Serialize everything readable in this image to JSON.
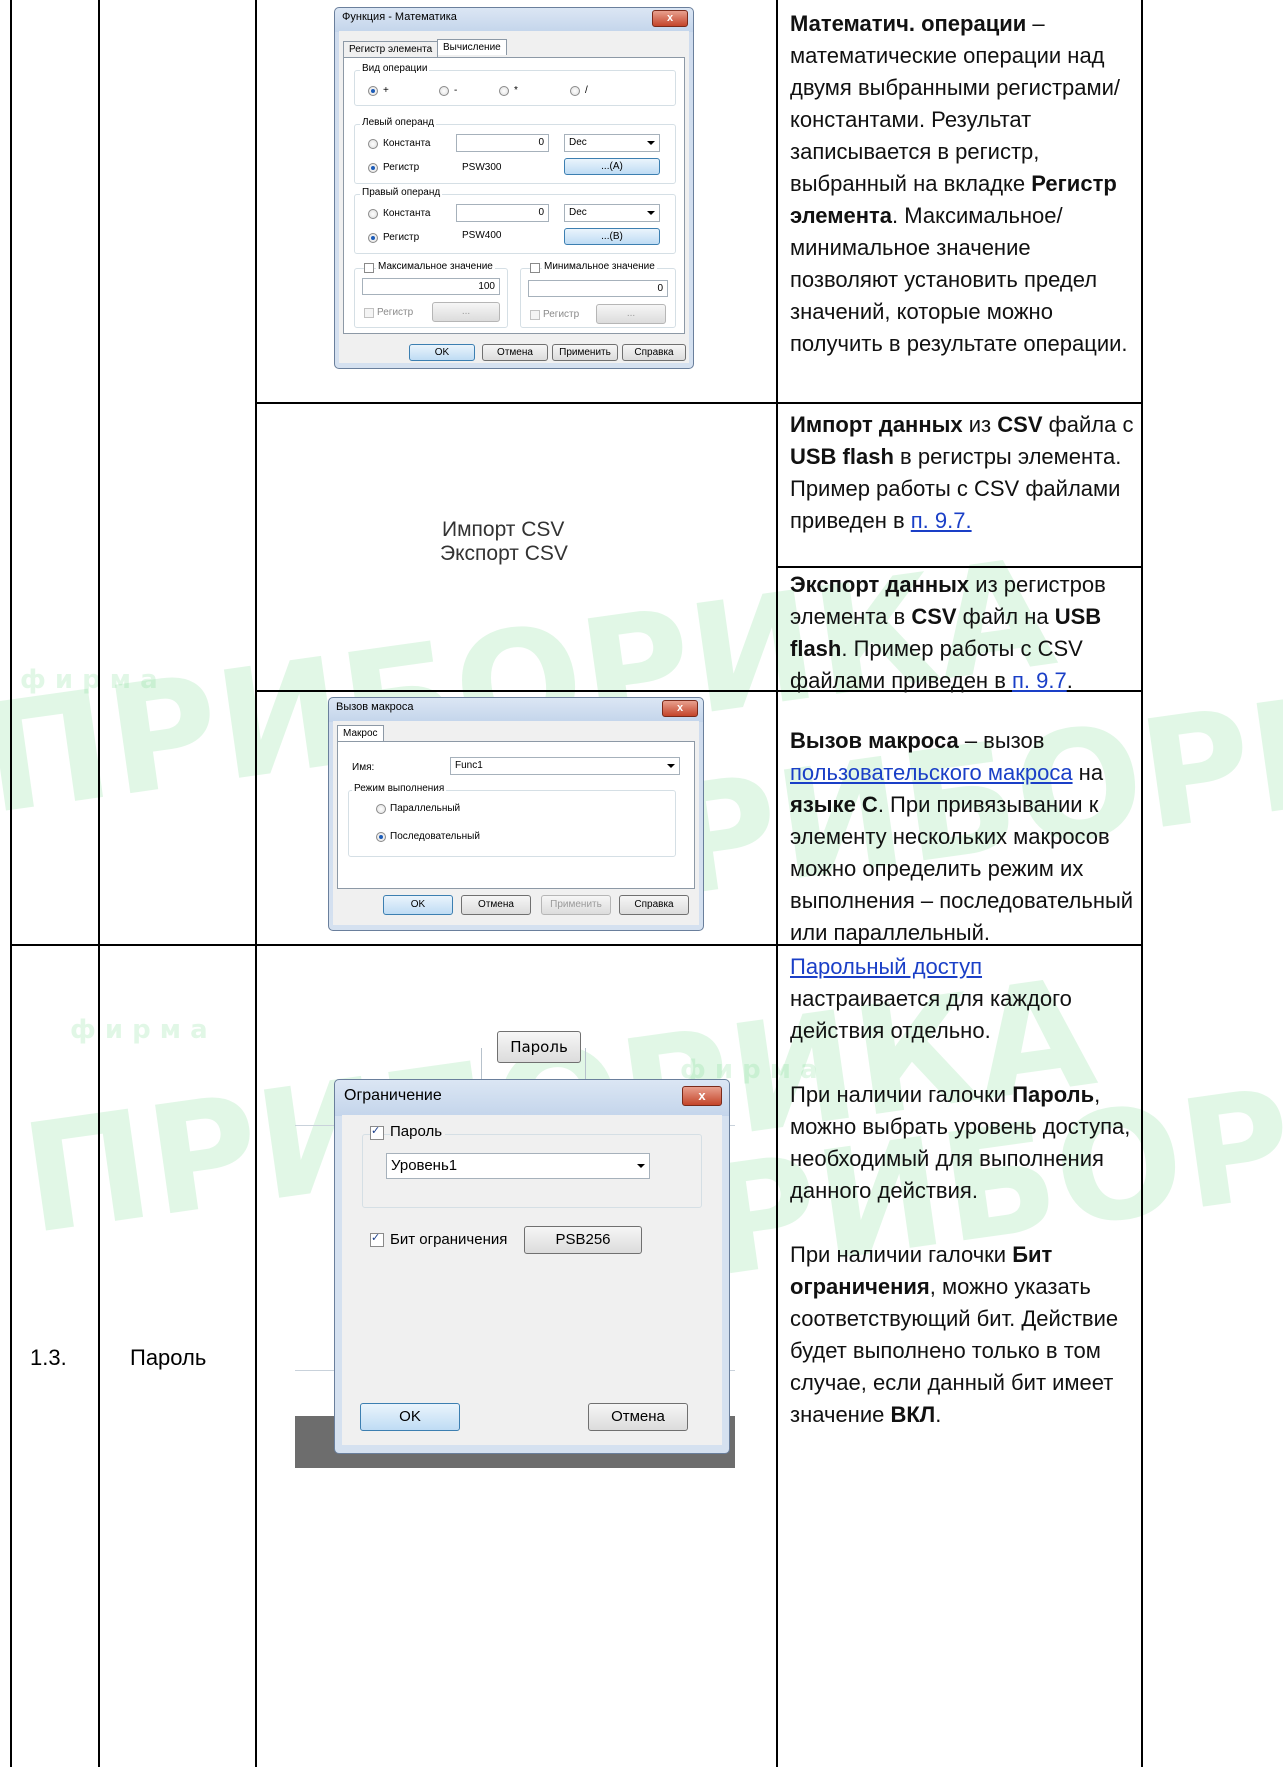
{
  "row_main": {
    "number": "1.3.",
    "name": "Пароль"
  },
  "math_dialog": {
    "title": "Функция - Математика",
    "close": "x",
    "tab_register": "Регистр элемента",
    "tab_calc": "Вычисление",
    "op_group": "Вид операции",
    "ops": [
      "+",
      "-",
      "*",
      "/"
    ],
    "left_group": "Левый операнд",
    "right_group": "Правый операнд",
    "constant": "Константа",
    "register": "Регистр",
    "left_const_value": "0",
    "left_format": "Dec",
    "left_register": "PSW300",
    "left_btn": "...(A)",
    "right_const_value": "0",
    "right_format": "Dec",
    "right_register": "PSW400",
    "right_btn": "...(B)",
    "max_label": "Максимальное значение",
    "max_value": "100",
    "min_label": "Минимальное значение",
    "min_value": "0",
    "reg_small": "Регистр",
    "dots": "...",
    "ok": "OK",
    "cancel": "Отмена",
    "apply": "Применить",
    "help": "Справка"
  },
  "math_desc": {
    "title_bold": "Математич. операции",
    "text": " – математические операции над двумя выбранными регистрами/константами. Результат записывается в регистр, выбранный на вкладке ",
    "tab_bold": "Регистр элемента",
    "text2": ". Максимальное/минимальное значение позволяют установить предел значений, которые можно получить в результате операции."
  },
  "csv": {
    "import_label": "Импорт CSV",
    "export_label": "Экспорт CSV",
    "import_bold": "Импорт данных",
    "import_t1": " из ",
    "csv_bold": "CSV",
    "import_t2": " файла с ",
    "usb_bold": "USB flash",
    "import_t3": " в регистры элемента. Пример работы с CSV файлами приведен в ",
    "link": "п. 9.7.",
    "export_bold": "Экспорт данных",
    "export_t1": " из регистров элемента в ",
    "export_t2": " файл на ",
    "export_t3": ". Пример работы с CSV файлами приведен в ",
    "link2": "п. 9.7",
    "dot": "."
  },
  "macro_dialog": {
    "title": "Вызов макроса",
    "close": "x",
    "tab": "Макрос",
    "name_label": "Имя:",
    "name_value": "Func1",
    "mode_group": "Режим выполнения",
    "parallel": "Параллельный",
    "sequential": "Последовательный",
    "ok": "OK",
    "cancel": "Отмена",
    "apply": "Применить",
    "help": "Справка"
  },
  "macro_desc": {
    "bold": "Вызов макроса",
    "t1": " – вызов ",
    "link": "пользовательского макроса",
    "t2": " на ",
    "lang_bold": "языке С",
    "t3": ". При привязывании к элементу нескольких макросов можно определить режим их выполнения – последовательный или параллельный."
  },
  "password_dialog": {
    "top_button": "Пароль",
    "title": "Ограничение",
    "close": "x",
    "pwd_check": "Пароль",
    "level": "Уровень1",
    "bit_check": "Бит ограничения",
    "bit_value": "PSB256",
    "ok": "OK",
    "cancel": "Отмена"
  },
  "password_desc": {
    "link": "Парольный доступ",
    "p1": " настраивается для каждого действия отдельно.",
    "p2a": "При наличии галочки ",
    "p2b": "Пароль",
    "p2c": ", можно выбрать уровень доступа, необходимый для выполнения данного действия.",
    "p3a": "При наличии галочки ",
    "p3b": "Бит ограничения",
    "p3c": ", можно указать соответствующий бит. Действие будет выполнено только в том случае, если данный бит имеет значение ",
    "p3d": "ВКЛ",
    "p3e": "."
  },
  "watermark": {
    "brand": "ПРИБОРИКА",
    "small": "ф и р м а"
  }
}
